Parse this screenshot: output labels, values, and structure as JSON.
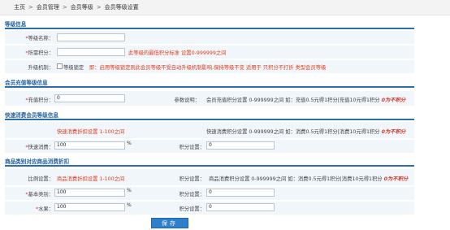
{
  "breadcrumb": [
    "主页",
    "会员管理",
    "会员等级",
    "会员等级设置"
  ],
  "sections": {
    "level_info": "等级信息",
    "recharge": "会员充值等级信息",
    "fast_consume": "快速消费会员等级信息",
    "product_category": "商品类别对应商品消费折扣"
  },
  "level_info": {
    "name_label": "等级名称：",
    "points_label": "所需积分：",
    "points_hint": "此等级的最低积分标准 设置0-999999之间",
    "upgrade_label": "升级机制：",
    "lock_label": "等级锁定",
    "lock_hint": "即：启用等级锁定则此会员等级不受自动升级机制影响,保持等级不变 适用于 只积分不打折 类型会员等级"
  },
  "recharge": {
    "points_label": "充值积分：",
    "points_value": "0",
    "param_label": "参数说明：",
    "param_text": "会员充值积分设置 0-999999之间 如：充值0.5元得1积分|充值10元得1积分",
    "param_em": "0为不积分"
  },
  "fast_consume": {
    "discount_hint": "快速消费折扣设置 1-100之间",
    "points_hint": "快速消费积分设置 0-999999之间 如：消费0.5元得1积分|消费10元得1积分",
    "points_em": "0为不积分",
    "consume_label": "快速消费：",
    "consume_value": "100",
    "pct": "%",
    "points_label": "积分设置：",
    "points_value": "0"
  },
  "product_category": {
    "ratio_label": "比例设置：",
    "discount_hint": "商品消费折扣设置 1-100之间",
    "points_label_top": "积分设置：",
    "points_hint": "商品消费积分设置 0-999999之间 如：消费0.5元得1积分|消费10元得1积分",
    "points_em": "0为不积分",
    "rows": [
      {
        "label": "基本类别：",
        "value": "100",
        "pct": "%",
        "points_label": "积分设置：",
        "points_value": "0"
      },
      {
        "label": "水果：",
        "value": "100",
        "pct": "%",
        "points_label": "积分设置：",
        "points_value": "0"
      }
    ]
  },
  "save_label": "保存"
}
